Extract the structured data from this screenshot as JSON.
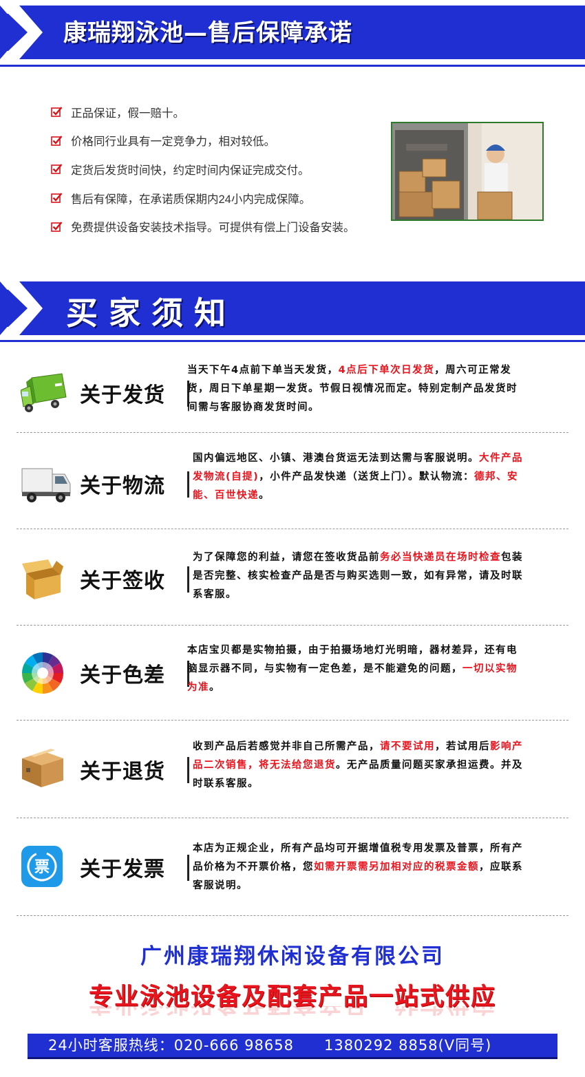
{
  "header": {
    "title": "康瑞翔泳池—售后保障承诺"
  },
  "guarantees": [
    "正品保证，假一赔十。",
    "价格同行业具有一定竞争力，相对较低。",
    "定货后发货时间快，约定时间内保证完成交付。",
    "售后有保障，在承诺质保期内24小内完成保障。",
    "免费提供设备安装技术指导。可提供有偿上门设备安装。"
  ],
  "notice_header": {
    "title": "买家须知"
  },
  "notices": [
    {
      "label": "关于发货",
      "icon": "truck-icon",
      "text": [
        {
          "t": "当天下午4点前下单当天发货，"
        },
        {
          "t": "4点后下单次日发货",
          "red": true
        },
        {
          "t": "，周六可正常发货，周日下单星期一发货。节假日视情况而定。特别定制产品发货时间需与客服协商发货时间。"
        }
      ]
    },
    {
      "label": "关于物流",
      "icon": "van-icon",
      "text": [
        {
          "t": "国内偏远地区、小镇、港澳台货运无法到达需与客服说明。"
        },
        {
          "t": "大件产品发物流(自提)",
          "red": true
        },
        {
          "t": "，小件产品发快递（送货上门）。默认物流："
        },
        {
          "t": "德邦、安能、百世快递",
          "red": true
        },
        {
          "t": "。"
        }
      ]
    },
    {
      "label": "关于签收",
      "icon": "open-box-icon",
      "text": [
        {
          "t": "为了保障您的利益，请您在签收货品前"
        },
        {
          "t": "务必当快递员在场时检查",
          "red": true
        },
        {
          "t": "包装是否完整、核实检查产品是否与购买选则一致，如有异常，请及时联系客服。"
        }
      ]
    },
    {
      "label": "关于色差",
      "icon": "color-wheel-icon",
      "text": [
        {
          "t": "本店宝贝都是实物拍摄，由于拍摄场地灯光明暗，器材差异，还有电脑显示器不同，与实物有一定色差，是不能避免的问题，"
        },
        {
          "t": "一切以实物为准",
          "red": true
        },
        {
          "t": "。"
        }
      ]
    },
    {
      "label": "关于退货",
      "icon": "box-icon",
      "text": [
        {
          "t": "收到产品后若感觉并非自己所需产品，"
        },
        {
          "t": "请不要试用",
          "red": true
        },
        {
          "t": "，若试用后"
        },
        {
          "t": "影响产品二次销售，将无法给您退货",
          "red": true
        },
        {
          "t": "。无产品质量问题买家承担运费。并及时联系客服。"
        }
      ]
    },
    {
      "label": "关于发票",
      "icon": "invoice-icon",
      "icon_text": "票",
      "text": [
        {
          "t": "本店为正规企业，所有产品均可开据增值税专用发票及普票，所有产品价格为不开票价格，您"
        },
        {
          "t": "如需开票需另加相对应的税票金额",
          "red": true
        },
        {
          "t": "，应联系客服说明。"
        }
      ]
    }
  ],
  "footer": {
    "company": "广州康瑞翔休闲设备有限公司",
    "slogan": "专业泳池设备及配套产品一站式供应",
    "hotline_label": "24小时客服热线：",
    "phone1": "020-666 98658",
    "phone2": "1380292 8858(V同号)"
  },
  "colors": {
    "brand_blue": "#1f2fd2",
    "accent_red": "#e8151e",
    "check_red": "#d8131b"
  }
}
